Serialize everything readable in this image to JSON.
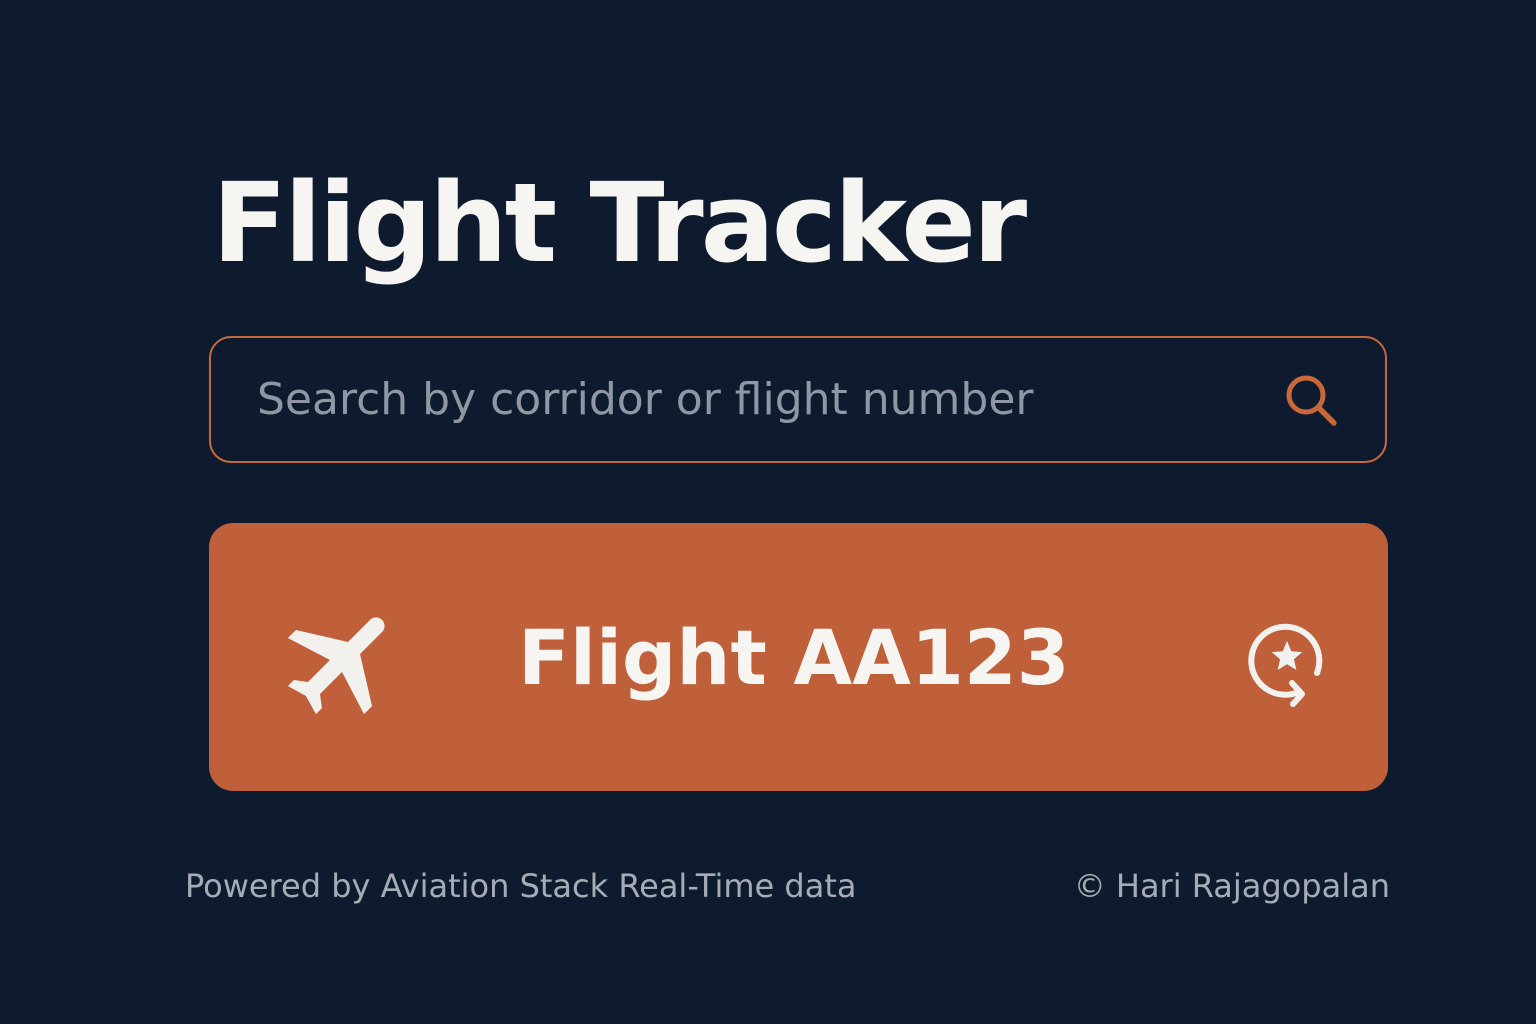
{
  "app": {
    "title": "Flight Tracker"
  },
  "search": {
    "value": "",
    "placeholder": "Search by corridor or flight number",
    "button_icon": "search-icon"
  },
  "flight_card": {
    "label": "Flight AA123",
    "leading_icon": "airplane-icon",
    "trailing_icon": "favorite-refresh-icon"
  },
  "footer": {
    "credit": "Powered by Aviation Stack Real-Time data",
    "copyright": "© Hari Rajagopalan"
  },
  "colors": {
    "background": "#0e1b2e",
    "accent": "#bf603a",
    "accent_border": "#c8683a",
    "text_primary": "#f7f5f2",
    "text_muted": "#a6acb6"
  }
}
